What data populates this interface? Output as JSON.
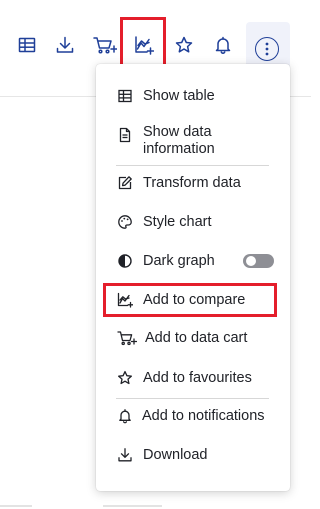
{
  "toolbar": {
    "buttons": [
      {
        "icon": "table-icon"
      },
      {
        "icon": "download-icon"
      },
      {
        "icon": "data-cart-icon"
      },
      {
        "icon": "add-to-compare-icon"
      },
      {
        "icon": "star-icon"
      },
      {
        "icon": "bell-icon"
      },
      {
        "icon": "more-options-icon"
      }
    ],
    "accent_color": "#1f3f98",
    "highlight_color": "#e41e2b"
  },
  "menu": {
    "show_table": "Show table",
    "show_data_information": "Show data information",
    "transform_data": "Transform data",
    "style_chart": "Style chart",
    "dark_graph": "Dark graph",
    "dark_graph_enabled": false,
    "add_to_compare": "Add to compare",
    "add_to_data_cart": "Add to data cart",
    "add_to_favourites": "Add to favourites",
    "add_to_notifications": "Add to notifications",
    "download": "Download"
  }
}
